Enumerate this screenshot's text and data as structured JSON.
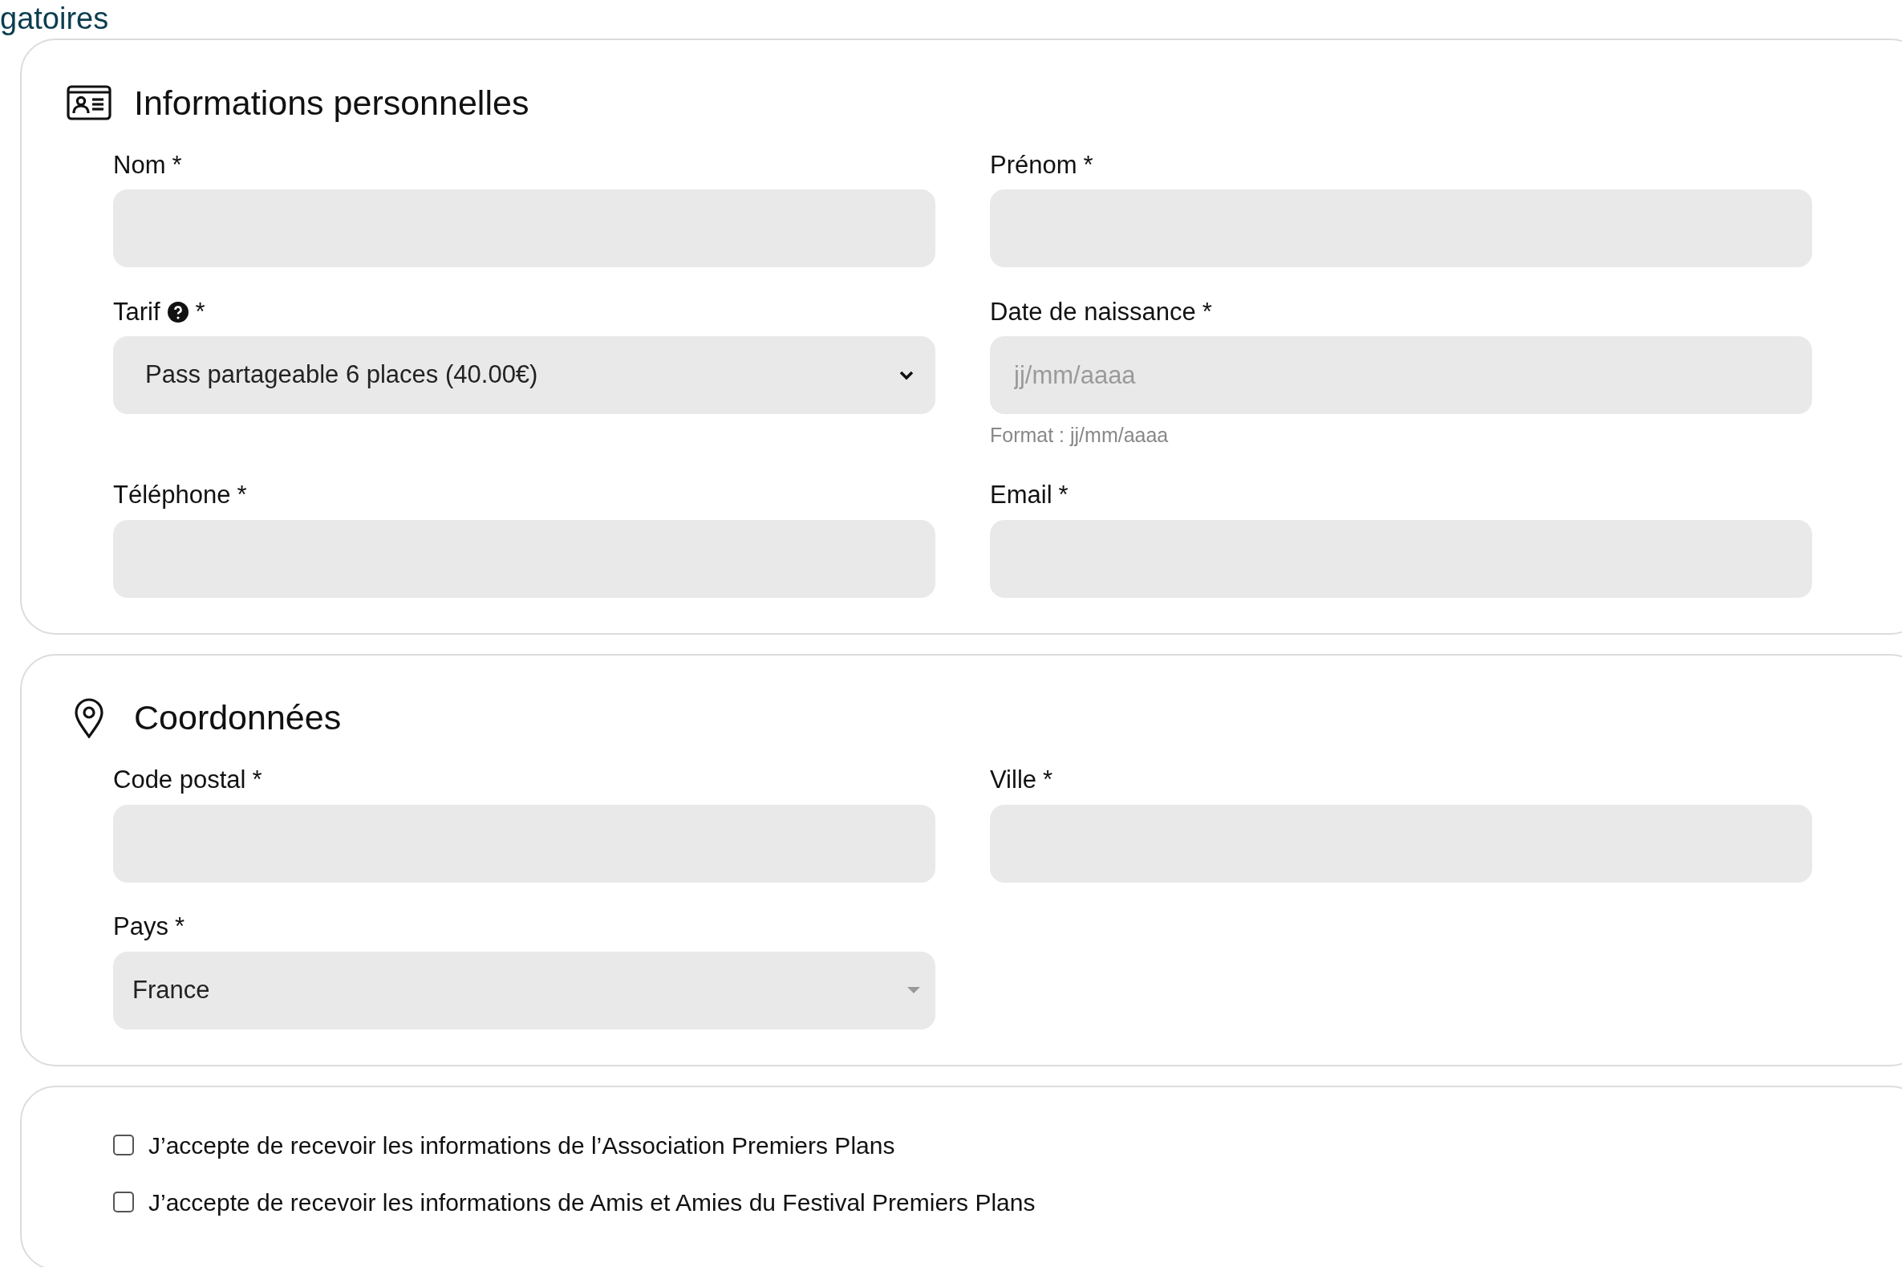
{
  "header_fragment": "gatoires",
  "sections": [
    {
      "kind": "personal",
      "title": "Informations personnelles",
      "fields": [
        {
          "kind": "input",
          "label": "Nom",
          "required": "*"
        },
        {
          "kind": "input",
          "label": "Prénom",
          "required": "*"
        },
        {
          "kind": "select",
          "label": "Tarif",
          "help": true,
          "required": "*",
          "value": "Pass partageable 6 places (40.00€)"
        },
        {
          "kind": "input",
          "label": "Date de naissance",
          "required": "*",
          "placeholder": "jj/mm/aaaa",
          "hint": "Format : jj/mm/aaaa"
        },
        {
          "kind": "input",
          "label": "Téléphone",
          "required": "*"
        },
        {
          "kind": "input",
          "label": "Email",
          "required": "*"
        }
      ]
    },
    {
      "kind": "address",
      "title": "Coordonnées",
      "fields": [
        {
          "kind": "input",
          "label": "Code postal",
          "required": "*"
        },
        {
          "kind": "input",
          "label": "Ville",
          "required": "*"
        },
        {
          "kind": "combobox",
          "label": "Pays",
          "required": "*",
          "value": "France"
        }
      ]
    }
  ],
  "consents": [
    {
      "label": "J’accepte de recevoir les informations de l’Association Premiers Plans",
      "checked": false
    },
    {
      "label": "J’accepte de recevoir les informations de Amis et Amies du Festival Premiers Plans",
      "checked": false
    }
  ]
}
